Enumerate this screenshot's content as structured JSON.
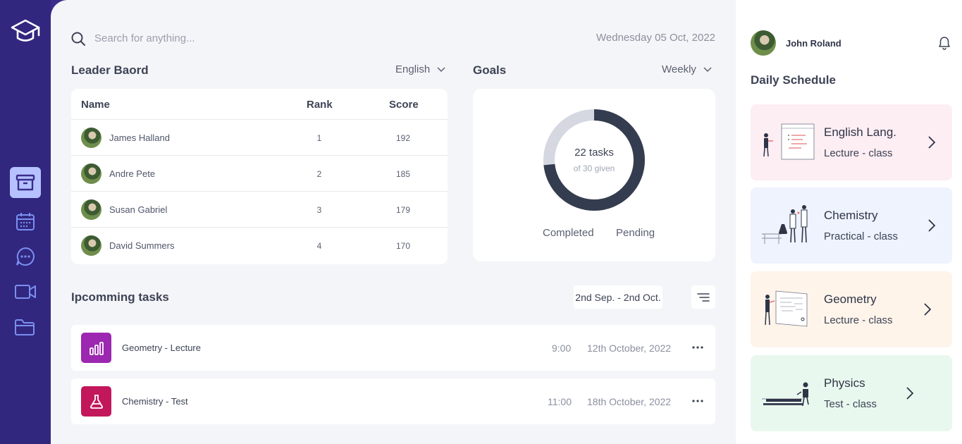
{
  "search": {
    "placeholder": "Search for anything..."
  },
  "date": "Wednesday 05 Oct, 2022",
  "leaderboard": {
    "title": "Leader Baord",
    "filter": "English",
    "columns": {
      "name": "Name",
      "rank": "Rank",
      "score": "Score"
    },
    "rows": [
      {
        "name": "James Halland",
        "rank": "1",
        "score": "192"
      },
      {
        "name": "Andre Pete",
        "rank": "2",
        "score": "185"
      },
      {
        "name": "Susan Gabriel",
        "rank": "3",
        "score": "179"
      },
      {
        "name": "David Summers",
        "rank": "4",
        "score": "170"
      }
    ]
  },
  "goals": {
    "title": "Goals",
    "period": "Weekly",
    "center_main": "22 tasks",
    "center_sub": "of 30 given",
    "completed": 22,
    "total": 30,
    "legend": {
      "completed": "Completed",
      "pending": "Pending"
    },
    "colors": {
      "completed": "#343c4f",
      "pending": "#d5d8e0"
    }
  },
  "tasks": {
    "title": "Ipcomming tasks",
    "range": "2nd Sep. - 2nd Oct.",
    "items": [
      {
        "name": "Geometry - Lecture",
        "time": "9:00",
        "date": "12th October, 2022",
        "icon": "bar-chart-icon",
        "color": "#9c27b0"
      },
      {
        "name": "Chemistry - Test",
        "time": "11:00",
        "date": "18th October, 2022",
        "icon": "flask-icon",
        "color": "#c2185b"
      }
    ]
  },
  "user": {
    "name": "John Roland"
  },
  "schedule": {
    "title": "Daily Schedule",
    "items": [
      {
        "name": "English Lang.",
        "type": "Lecture - class",
        "bg": "#fdeef3"
      },
      {
        "name": "Chemistry",
        "type": "Practical - class",
        "bg": "#eef3fe"
      },
      {
        "name": "Geometry",
        "type": "Lecture - class",
        "bg": "#fef4ea"
      },
      {
        "name": "Physics",
        "type": "Test - class",
        "bg": "#e9f8ee"
      }
    ]
  },
  "sidebar": {
    "icons": [
      "graduation-cap-icon",
      "archive-icon",
      "calendar-icon",
      "chat-icon",
      "video-icon",
      "folder-icon"
    ],
    "accent": "#b6c2ff"
  }
}
